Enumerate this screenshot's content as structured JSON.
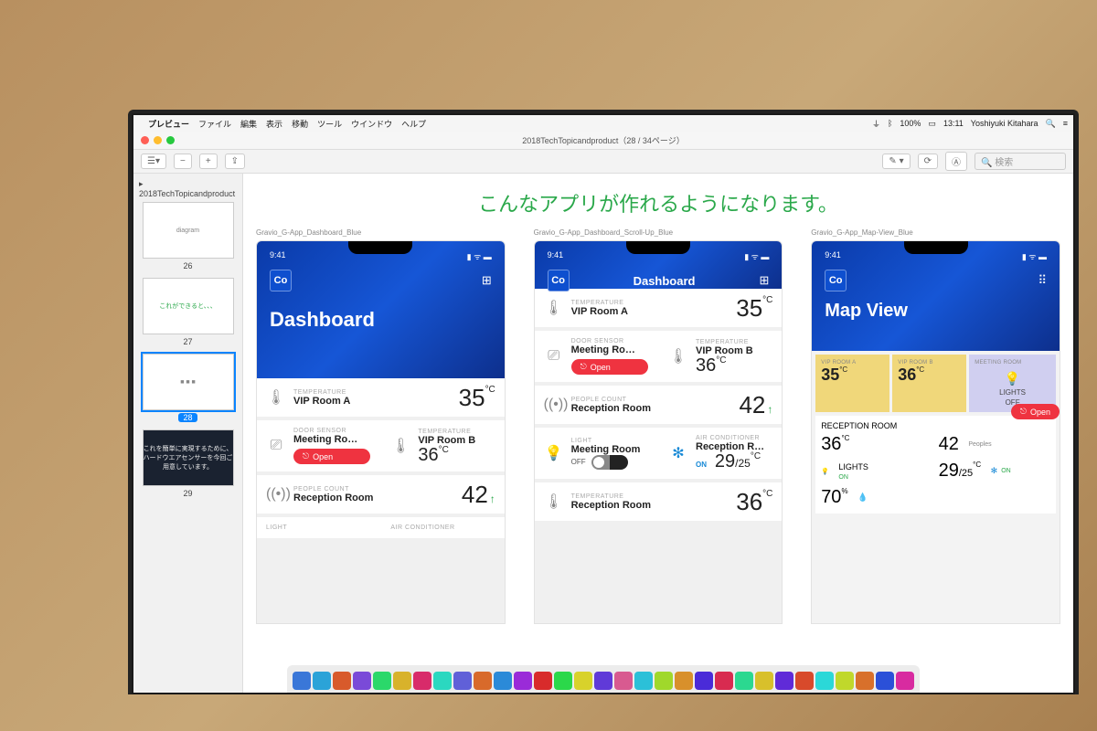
{
  "menubar": {
    "app": "プレビュー",
    "items": [
      "ファイル",
      "編集",
      "表示",
      "移動",
      "ツール",
      "ウインドウ",
      "ヘルプ"
    ],
    "battery": "100%",
    "time": "13:11",
    "user": "Yoshiyuki Kitahara"
  },
  "window": {
    "title": "2018TechTopicandproduct（28 / 34ページ）",
    "search_placeholder": "検索"
  },
  "sidebar": {
    "doc_name": "2018TechTopicandproduct",
    "thumbs": [
      {
        "num": "26",
        "caption": ""
      },
      {
        "num": "27",
        "caption": "これができると、、、"
      },
      {
        "num": "28",
        "caption": "",
        "selected": true
      },
      {
        "num": "29",
        "caption": "これを簡単に実現するために、ハードウエアセンサーを今回ご用意しています。",
        "dark": true
      }
    ]
  },
  "slide": {
    "title": "こんなアプリが作れるようになります。",
    "mock_labels": [
      "Gravio_G-App_Dashboard_Blue",
      "Gravio_G-App_Dashboard_Scroll-Up_Blue",
      "Gravio_G-App_Map-View_Blue"
    ],
    "status_time": "9:41",
    "co": "Co",
    "dashboard_title": "Dashboard",
    "mapview_title": "Map View",
    "labels": {
      "temperature": "TEMPERATURE",
      "door_sensor": "DOOR SENSOR",
      "people_count": "PEOPLE COUNT",
      "light": "LIGHT",
      "air_conditioner": "AIR CONDITIONER",
      "lights": "LIGHTS",
      "off": "OFF",
      "on": "ON",
      "open": "Open",
      "peoples": "Peoples"
    },
    "rooms": {
      "vip_a": "VIP Room A",
      "vip_b": "VIP Room B",
      "meeting": "Meeting Ro…",
      "meeting_full": "Meeting Room",
      "reception": "Reception Room",
      "reception_short": "Reception R…",
      "vip_a_uc": "VIP ROOM A",
      "vip_b_uc": "VIP ROOM B",
      "meeting_uc": "MEETING ROOM",
      "reception_uc": "RECEPTION ROOM"
    },
    "values": {
      "vip_a_temp": "35",
      "vip_b_temp": "36",
      "reception_count": "42",
      "ac_set": "29",
      "ac_cur": "25",
      "reception_temp": "36",
      "humidity": "70"
    },
    "units": {
      "c": "°C",
      "pct": "%"
    }
  },
  "dock_colors": [
    "#3a77d8",
    "#2ba3d8",
    "#d85a2b",
    "#7a4ad8",
    "#2bd86a",
    "#d8b22b",
    "#d82b6a",
    "#2bd8c0",
    "#6060d8",
    "#d86a2b",
    "#2b8ad8",
    "#9a2bd8",
    "#d82b2b",
    "#2bd84a",
    "#d8d22b",
    "#603ad8",
    "#d85a90",
    "#2bc0d8",
    "#a0d82b",
    "#d8902b",
    "#4a2bd8",
    "#d82b50",
    "#2bd890",
    "#d8c02b",
    "#602bd8",
    "#d84a2b",
    "#2bd8d8",
    "#c0d82b",
    "#d8702b",
    "#2b50d8",
    "#d82ba0"
  ]
}
